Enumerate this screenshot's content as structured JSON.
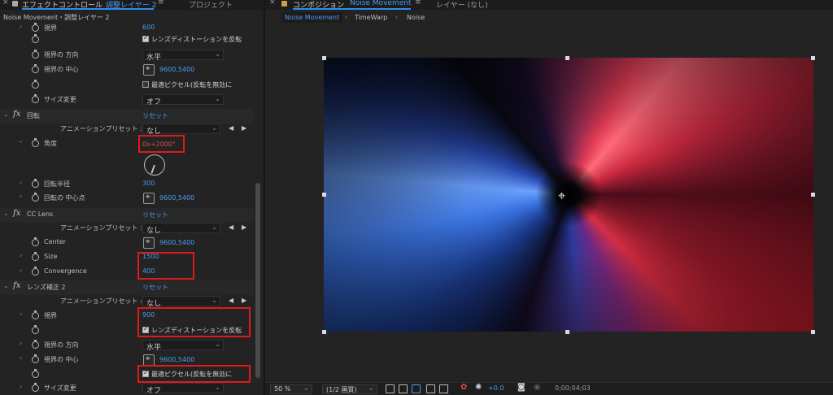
{
  "left_tabs": {
    "close": "×",
    "panel_title": "エフェクトコントロール",
    "panel_target": "調整レイヤー 2",
    "menu": "≡",
    "project_tab": "プロジェクト"
  },
  "breadcrumb": "Noise Movement・調整レイヤー 2",
  "lens1": {
    "fov_label": "視界",
    "fov_value": "600",
    "reverse_label": "レンズディストーションを反転",
    "fov_orient_label": "視界の 方向",
    "fov_orient_value": "水平",
    "fov_center_label": "視界の 中心",
    "fov_center_value": "9600,5400",
    "optimal_label": "最適ピクセル(反転を無効に",
    "resize_label": "サイズ変更",
    "resize_value": "オフ"
  },
  "twirl": {
    "name": "回転",
    "reset": "リセット",
    "preset_label": "アニメーションプリセット :",
    "preset_value": "なし",
    "angle_label": "角度",
    "angle_value": "0x+2000°",
    "radius_label": "回転半径",
    "radius_value": "300",
    "center_label": "回転の 中心点",
    "center_value": "9600,5400"
  },
  "cc_lens": {
    "name": "CC Lens",
    "reset": "リセット",
    "preset_label": "アニメーションプリセット :",
    "preset_value": "なし",
    "center_label": "Center",
    "center_value": "9600,5400",
    "size_label": "Size",
    "size_value": "1500",
    "convergence_label": "Convergence",
    "convergence_value": "400"
  },
  "lens2": {
    "name": "レンズ補正 2",
    "reset": "リセット",
    "preset_label": "アニメーションプリセット :",
    "preset_value": "なし",
    "fov_label": "視界",
    "fov_value": "900",
    "reverse_label": "レンズディストーションを反転",
    "fov_orient_label": "視界の 方向",
    "fov_orient_value": "水平",
    "fov_center_label": "視界の 中心",
    "fov_center_value": "9600,5400",
    "optimal_label": "最適ピクセル(反転を無効に",
    "resize_label": "サイズ変更",
    "resize_value": "オフ"
  },
  "right_tabs": {
    "close": "×",
    "panel_title": "コンポジション",
    "comp_name": "Noise Movement",
    "menu": "≡",
    "layer_tab": "レイヤー (なし)"
  },
  "comp_tabs": [
    "Noise Movement",
    "TimeWarp",
    "Noise"
  ],
  "bottom_bar": {
    "zoom": "50 %",
    "resolution": "(1/2 画質)",
    "exposure": "+0.0",
    "timecode": "0;00;04;03"
  },
  "icons": {
    "anchor": "anchor-point-icon",
    "stopwatch": "stopwatch-icon"
  },
  "colors": {
    "accent_blue": "#4a9bf0",
    "highlight_red": "#e01a1a"
  }
}
